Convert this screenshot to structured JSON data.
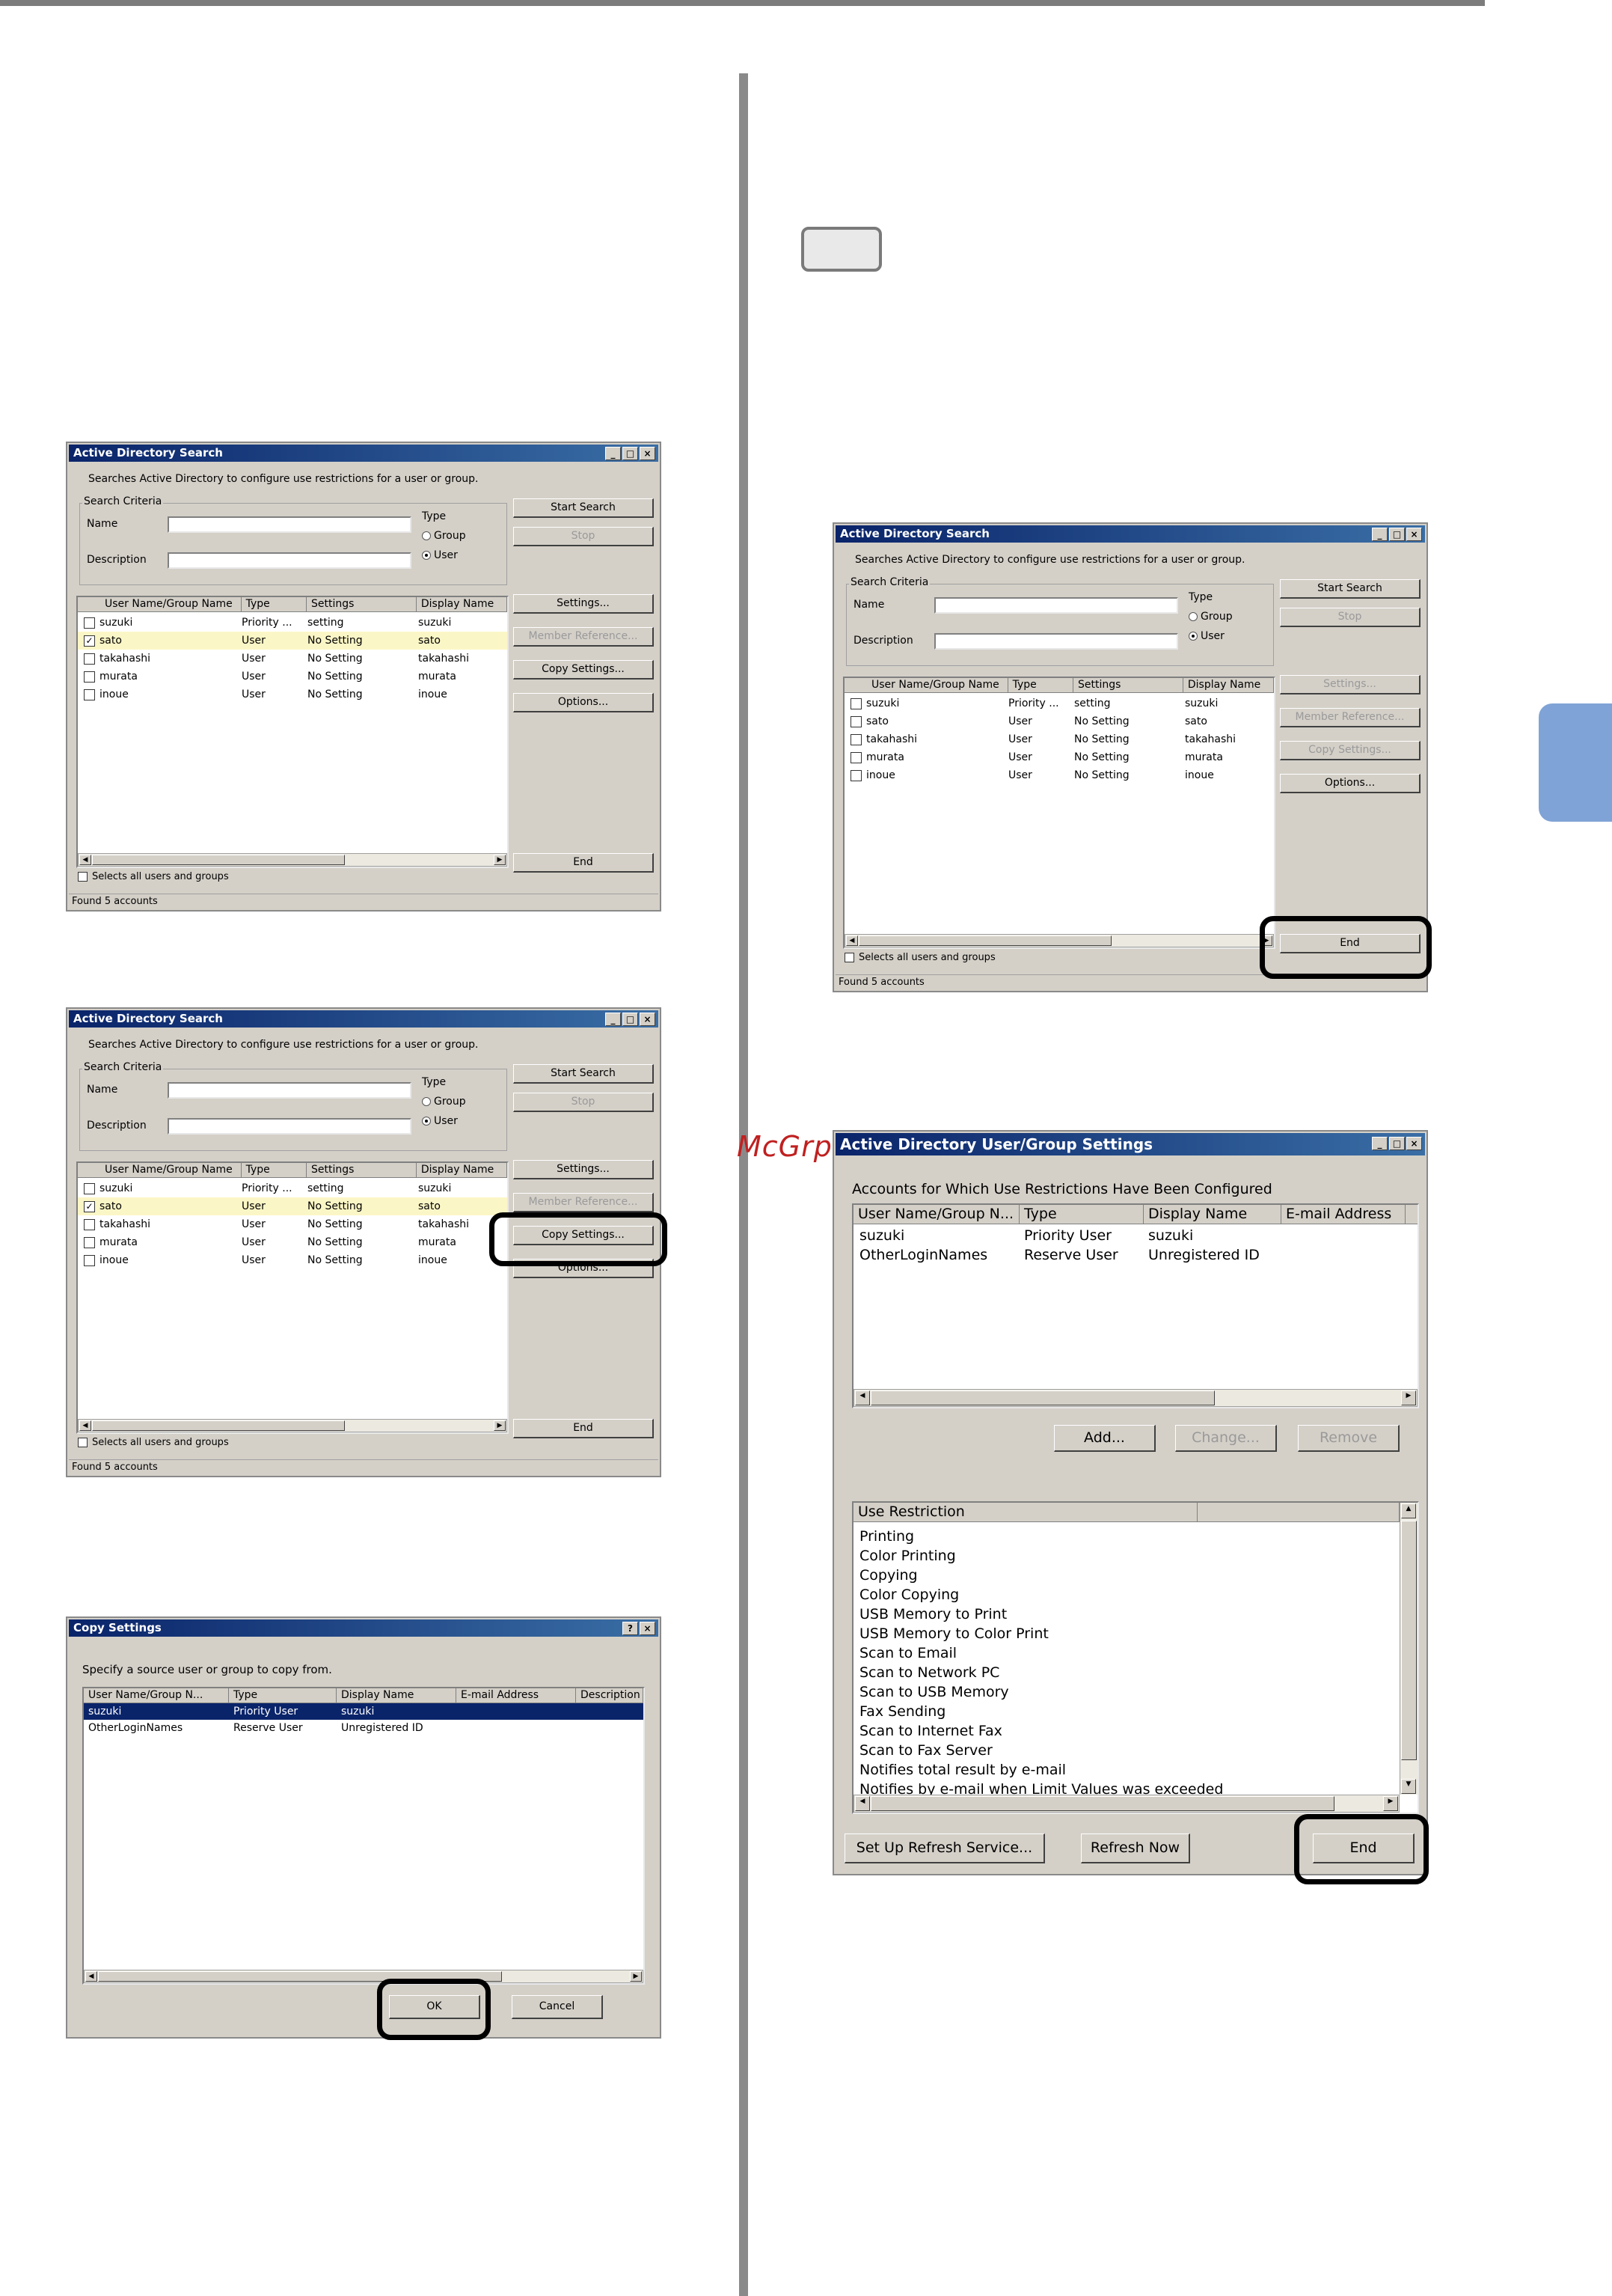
{
  "watermark": "McGrp.Ru",
  "ad": {
    "title": "Active Directory Search",
    "description": "Searches Active Directory to configure use restrictions for a user or group.",
    "criteria_label": "Search Criteria",
    "name_label": "Name",
    "desc_label": "Description",
    "type_label": "Type",
    "group_label": "Group",
    "user_label": "User",
    "columns": [
      "User Name/Group Name",
      "Type",
      "Settings",
      "Display Name"
    ],
    "rows": [
      [
        "suzuki",
        "Priority ...",
        "setting",
        "suzuki"
      ],
      [
        "sato",
        "User",
        "No Setting",
        "sato"
      ],
      [
        "takahashi",
        "User",
        "No Setting",
        "takahashi"
      ],
      [
        "murata",
        "User",
        "No Setting",
        "murata"
      ],
      [
        "inoue",
        "User",
        "No Setting",
        "inoue"
      ]
    ],
    "start_search": "Start Search",
    "stop": "Stop",
    "settings": "Settings...",
    "member_reference": "Member Reference...",
    "copy_settings": "Copy Settings...",
    "options": "Options...",
    "end": "End",
    "select_all": "Selects all users and groups",
    "status": "Found 5 accounts"
  },
  "copy": {
    "title": "Copy Settings",
    "help": "?",
    "prompt": "Specify a source user or group to copy from.",
    "columns": [
      "User Name/Group N...",
      "Type",
      "Display Name",
      "E-mail Address",
      "Description"
    ],
    "rows": [
      [
        "suzuki",
        "Priority User",
        "suzuki",
        "",
        ""
      ],
      [
        "OtherLoginNames",
        "Reserve User",
        "Unregistered ID",
        "",
        ""
      ]
    ],
    "ok": "OK",
    "cancel": "Cancel"
  },
  "ug": {
    "title": "Active Directory User/Group Settings",
    "accounts_label": "Accounts for Which Use Restrictions Have Been Configured",
    "columns": [
      "User Name/Group N...",
      "Type",
      "Display Name",
      "E-mail Address"
    ],
    "rows": [
      [
        "suzuki",
        "Priority User",
        "suzuki",
        ""
      ],
      [
        "OtherLoginNames",
        "Reserve User",
        "Unregistered ID",
        ""
      ]
    ],
    "add": "Add...",
    "change": "Change...",
    "remove": "Remove",
    "restriction_header": "Use Restriction",
    "restrictions": [
      "Printing",
      "Color Printing",
      "Copying",
      "Color Copying",
      "USB Memory to Print",
      "USB Memory to Color Print",
      "Scan to Email",
      "Scan to Network PC",
      "Scan to USB Memory",
      "Fax Sending",
      "Scan to Internet Fax",
      "Scan to Fax Server",
      "Notifies total result by e-mail",
      "Notifies by e-mail when Limit Values was exceeded"
    ],
    "setup_refresh": "Set Up Refresh Service...",
    "refresh_now": "Refresh Now",
    "end": "End"
  }
}
